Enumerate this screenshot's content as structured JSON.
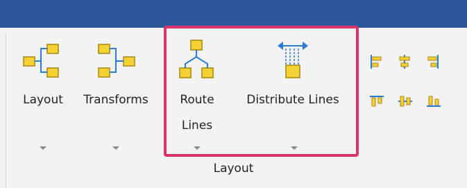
{
  "ribbon": {
    "group_label": "Layout",
    "buttons": [
      {
        "id": "layout",
        "label_lines": [
          "Layout"
        ],
        "icon": "layout-icon"
      },
      {
        "id": "transforms",
        "label_lines": [
          "Transforms"
        ],
        "icon": "transforms-icon"
      },
      {
        "id": "route-lines",
        "label_lines": [
          "Route",
          "Lines"
        ],
        "icon": "route-lines-icon"
      },
      {
        "id": "distribute-lines",
        "label_lines": [
          "Distribute Lines"
        ],
        "icon": "distribute-lines-icon"
      }
    ],
    "small_buttons": [
      {
        "icon": "align-left-icon"
      },
      {
        "icon": "align-center-icon"
      },
      {
        "icon": "align-right-icon"
      },
      {
        "icon": "align-top-icon"
      },
      {
        "icon": "align-middle-icon"
      },
      {
        "icon": "align-bottom-icon"
      }
    ]
  },
  "colors": {
    "titlebar": "#2b579a",
    "highlight": "#e0336a",
    "node_fill": "#f5d233",
    "node_stroke": "#a8860f",
    "accent_blue": "#2b7bd4"
  }
}
